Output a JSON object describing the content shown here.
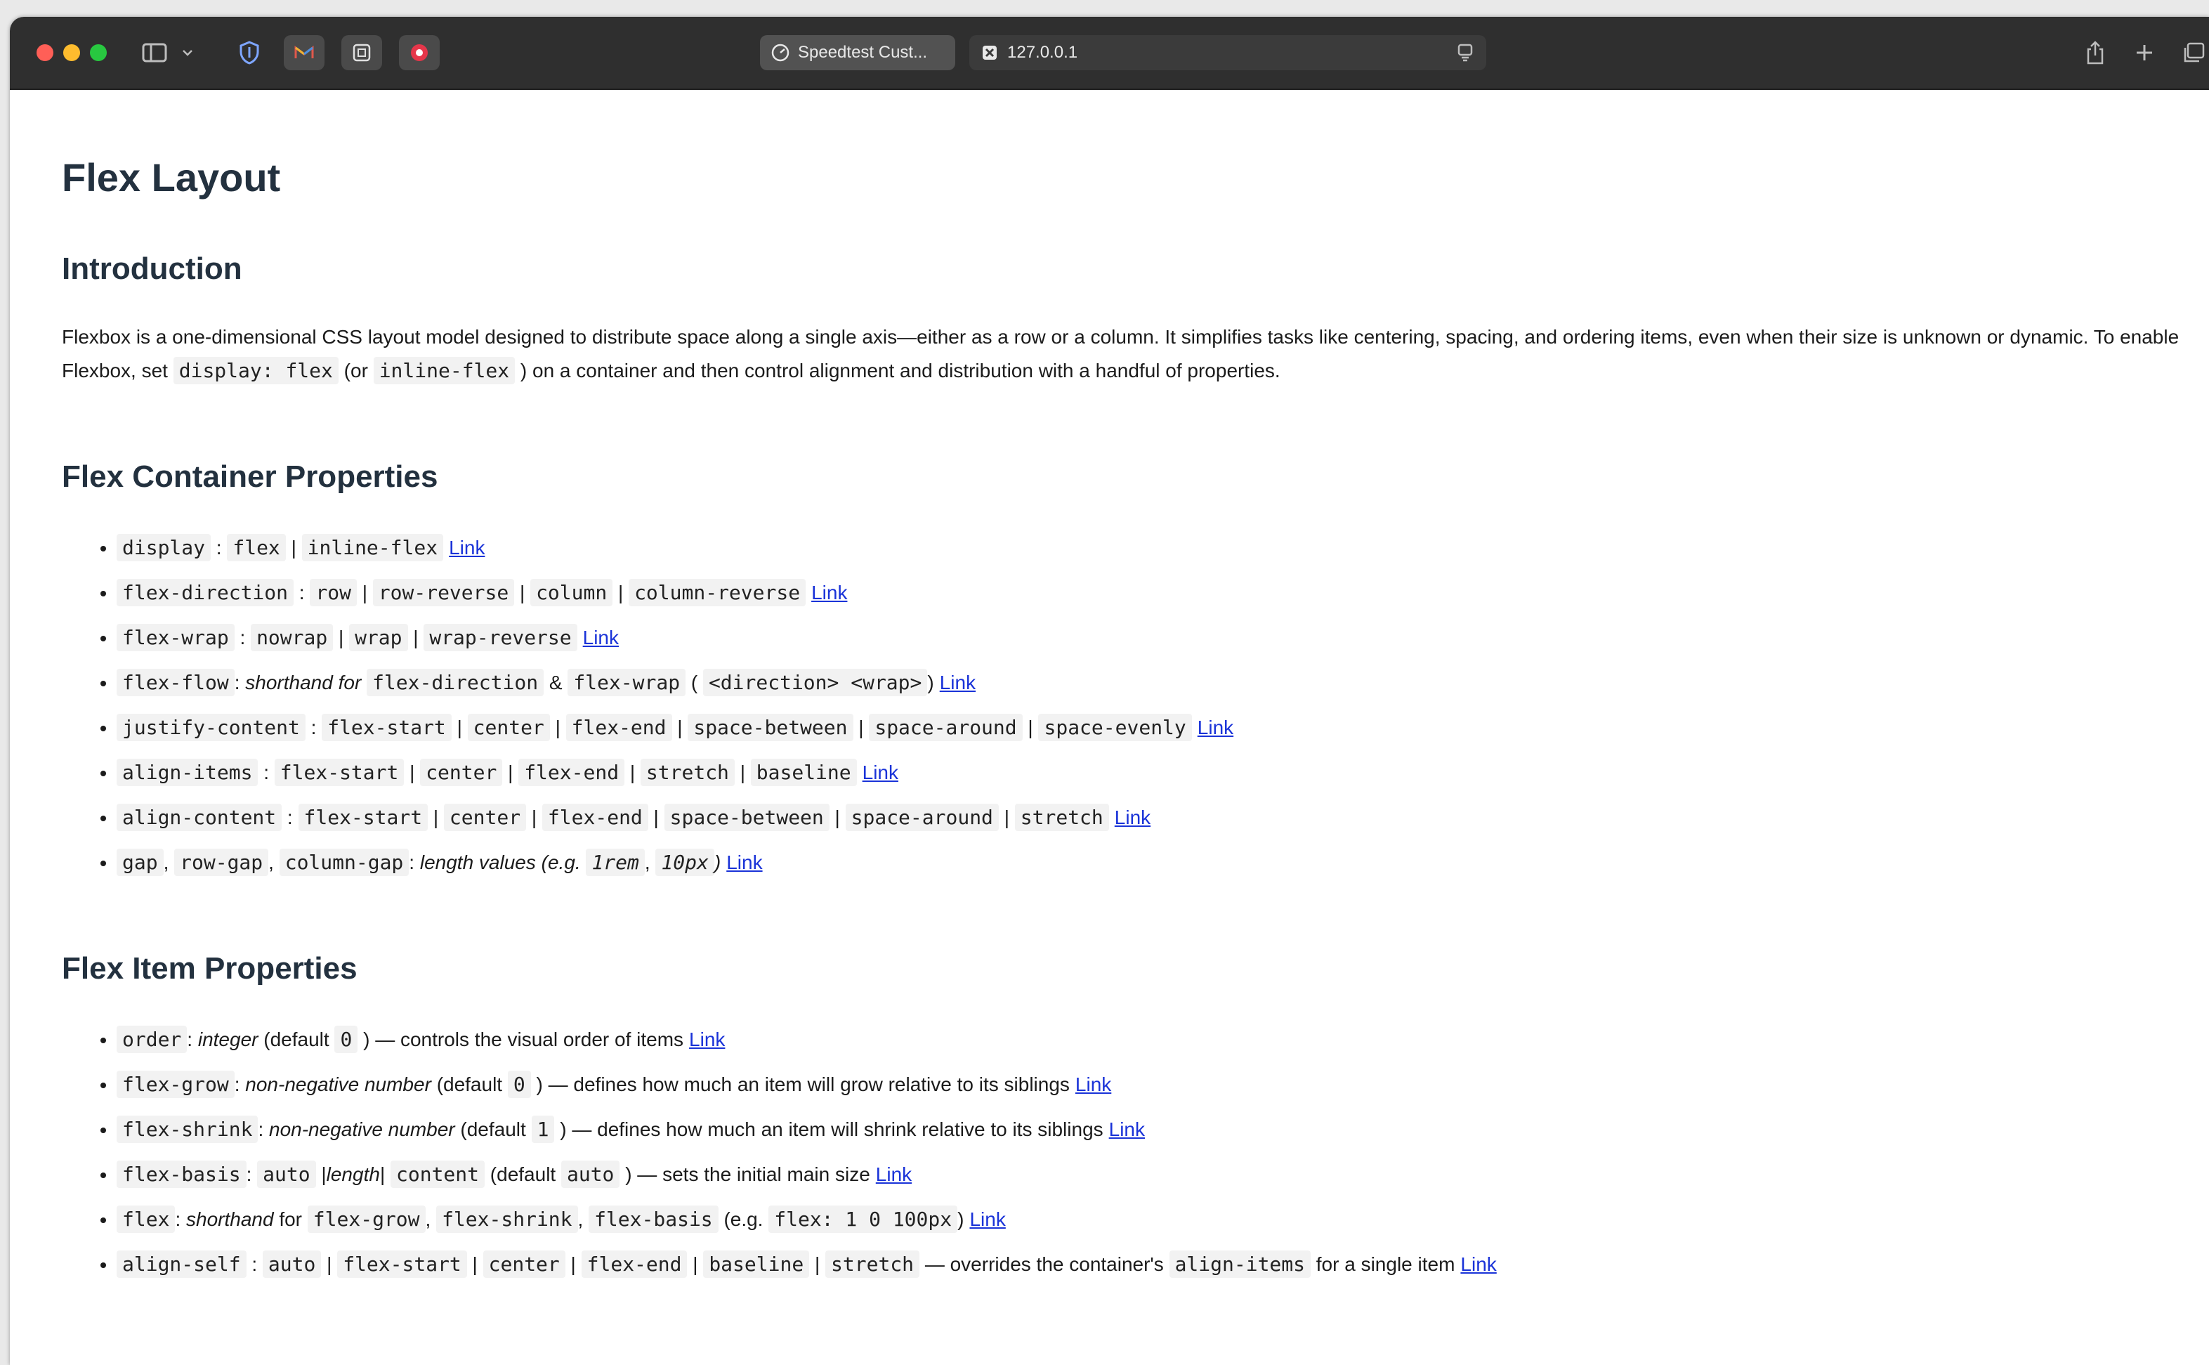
{
  "browser": {
    "tabs": [
      {
        "label": "Speedtest Cust..."
      },
      {
        "label": "127.0.0.1"
      }
    ]
  },
  "page": {
    "title": "Flex Layout",
    "intro_heading": "Introduction",
    "intro": {
      "p1": "Flexbox is a one-dimensional CSS layout model designed to distribute space along a single axis—either as a row or a column. It simplifies tasks like centering, spacing, and ordering items, even when their size is unknown or dynamic. To enable Flexbox, set",
      "c1": "display: flex",
      "p2": "(or",
      "c2": "inline-flex",
      "p3": ") on a container and then control alignment and distribution with a handful of properties."
    },
    "container_heading": "Flex Container Properties",
    "item_heading": "Flex Item Properties",
    "link_label": "Link"
  },
  "container_props": [
    {
      "name": "display",
      "sep": ":",
      "values": [
        "flex",
        "inline-flex"
      ]
    },
    {
      "name": "flex-direction",
      "sep": ":",
      "values": [
        "row",
        "row-reverse",
        "column",
        "column-reverse"
      ]
    },
    {
      "name": "flex-wrap",
      "sep": ":",
      "values": [
        "nowrap",
        "wrap",
        "wrap-reverse"
      ]
    },
    {
      "name": "justify-content",
      "sep": ":",
      "values": [
        "flex-start",
        "center",
        "flex-end",
        "space-between",
        "space-around",
        "space-evenly"
      ]
    },
    {
      "name": "align-items",
      "sep": ":",
      "values": [
        "flex-start",
        "center",
        "flex-end",
        "stretch",
        "baseline"
      ]
    },
    {
      "name": "align-content",
      "sep": ":",
      "values": [
        "flex-start",
        "center",
        "flex-end",
        "space-between",
        "space-around",
        "stretch"
      ]
    }
  ],
  "flex_flow": {
    "name": "flex-flow",
    "t1": ": ",
    "t1em": "shorthand for",
    "c1": "flex-direction",
    "t2": "&",
    "c2": "flex-wrap",
    "t3": "(",
    "c3": "<direction> <wrap>",
    "t4": ")"
  },
  "gap": {
    "c1": "gap",
    "t1": ",",
    "c2": "row-gap",
    "t2": ",",
    "c3": "column-gap",
    "t3": ":",
    "em1": "length values (e.g.",
    "c4": "1rem",
    "t4": ",",
    "c5": "10px",
    "em2": ")"
  },
  "item_props": {
    "order": {
      "name": "order",
      "t1": ":",
      "em1": "integer",
      "t2": "(default",
      "c1": "0",
      "t3": ") — controls the visual order of items"
    },
    "grow": {
      "name": "flex-grow",
      "t1": ":",
      "em1": "non-negative number",
      "t2": "(default",
      "c1": "0",
      "t3": ") — defines how much an item will grow relative to its siblings"
    },
    "shrink": {
      "name": "flex-shrink",
      "t1": ":",
      "em1": "non-negative number",
      "t2": "(default",
      "c1": "1",
      "t3": ") — defines how much an item will shrink relative to its siblings"
    },
    "basis": {
      "name": "flex-basis",
      "t1": ":",
      "c1": "auto",
      "t2": "|",
      "em1": "length",
      "t3": "|",
      "c2": "content",
      "t4": "(default",
      "c3": "auto",
      "t5": ") — sets the initial main size"
    },
    "flex": {
      "name": "flex",
      "t1": ":",
      "em1": "shorthand",
      "t2": "for",
      "c1": "flex-grow",
      "t3": ",",
      "c2": "flex-shrink",
      "t4": ",",
      "c3": "flex-basis",
      "t5": "(e.g.",
      "c4": "flex: 1 0 100px",
      "t6": ")"
    },
    "alignself": {
      "name": "align-self",
      "t1": ":",
      "values": [
        "auto",
        "flex-start",
        "center",
        "flex-end",
        "baseline",
        "stretch"
      ],
      "t2": "— overrides the container's",
      "c1": "align-items",
      "t3": "for a single item"
    }
  },
  "colors": {
    "link": "#1a33d8",
    "toolbar": "#2f2f2f",
    "heading": "#23313f"
  }
}
